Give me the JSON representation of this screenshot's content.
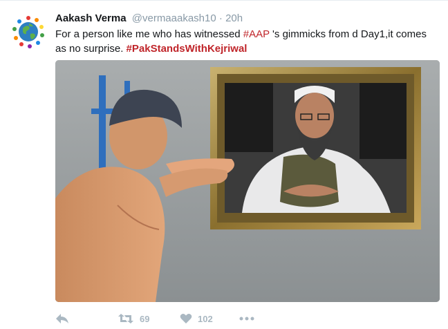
{
  "tweet": {
    "author_name": "Aakash Verma",
    "handle": "@vermaaakash10",
    "separator": "·",
    "time": "20h",
    "text_start": "For a person like me who has witnessed ",
    "hashtag_aap": "#AAP",
    "text_mid": " 's gimmicks from d Day1,it comes as no surprise. ",
    "hashtag_pak": "#PakStandsWithKejriwal",
    "retweet_count": "69",
    "like_count": "102"
  },
  "icons": {
    "reply": "reply-icon",
    "retweet": "retweet-icon",
    "like": "heart-icon",
    "more": "more-icon",
    "avatar": "globe-people-avatar"
  },
  "colors": {
    "hashtag": "#c0252a",
    "meta_gray": "#8899a6",
    "action_gray": "#aab8c2"
  }
}
